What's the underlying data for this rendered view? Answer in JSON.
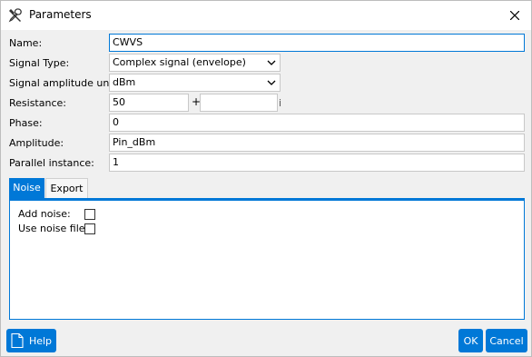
{
  "window": {
    "title": "Parameters",
    "close_icon": "close-icon",
    "title_icon": "tools-icon"
  },
  "form": {
    "name": {
      "label": "Name:",
      "value": "CWVS"
    },
    "signal_type": {
      "label": "Signal Type:",
      "value": "Complex signal (envelope)"
    },
    "amplitude_units": {
      "label": "Signal amplitude units:",
      "value": "dBm"
    },
    "resistance": {
      "label": "Resistance:",
      "real": "50",
      "plus": "+",
      "imag": "",
      "imag_unit": "i"
    },
    "phase": {
      "label": "Phase:",
      "value": "0"
    },
    "amplitude": {
      "label": "Amplitude:",
      "value": "Pin_dBm"
    },
    "parallel_instance": {
      "label": "Parallel instance:",
      "value": "1"
    }
  },
  "tabs": [
    {
      "label": "Noise",
      "active": true
    },
    {
      "label": "Export",
      "active": false
    }
  ],
  "noise": {
    "add_noise": {
      "label": "Add noise:",
      "checked": false
    },
    "use_noise_file": {
      "label": "Use noise file:",
      "checked": false
    }
  },
  "footer": {
    "help_label": "Help",
    "ok_label": "OK",
    "cancel_label": "Cancel"
  },
  "colors": {
    "accent": "#0078d7",
    "field_border": "#c8c8c8",
    "background": "#f0f0f0"
  }
}
